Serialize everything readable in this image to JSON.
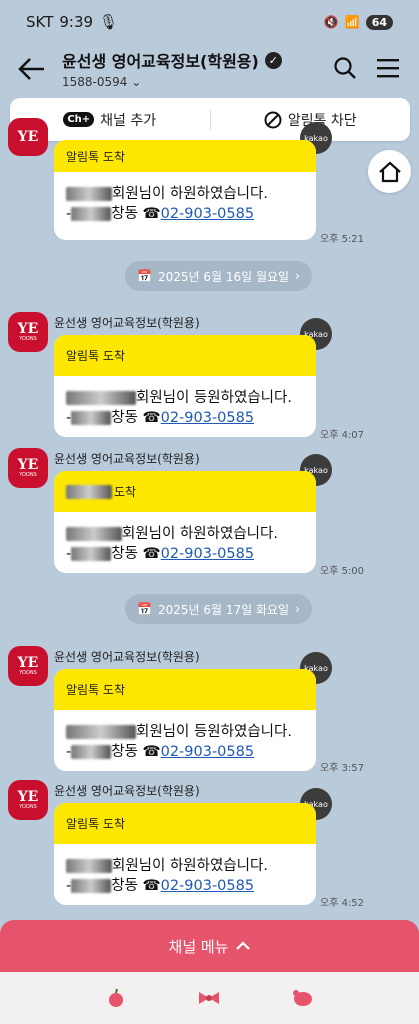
{
  "status": {
    "carrier": "SKT",
    "time": "9:39",
    "battery": "64"
  },
  "header": {
    "title": "윤선생 영어교육정보(학원용)",
    "phone": "1588-0594"
  },
  "actions": {
    "add_channel": "채널 추가",
    "block": "알림톡 차단"
  },
  "messages": [
    {
      "sender": "",
      "head": "알림톡 도착",
      "line1_suffix": "회원님이 하원하였습니다.",
      "line2_mid": "창동 ☎",
      "phone_link": "02-903-0585",
      "time": "오후 5:21"
    },
    {
      "sender": "윤선생 영어교육정보(학원용)",
      "head": "알림톡 도착",
      "line1_suffix": "회원님이 등원하였습니다.",
      "line2_mid": "창동 ☎",
      "phone_link": "02-903-0585",
      "time": "오후 4:07"
    },
    {
      "sender": "윤선생 영어교육정보(학원용)",
      "head": "도착",
      "line1_suffix": "회원님이 하원하였습니다.",
      "line2_mid": "창동 ☎",
      "phone_link": "02-903-0585",
      "time": "오후 5:00"
    },
    {
      "sender": "윤선생 영어교육정보(학원용)",
      "head": "알림톡 도착",
      "line1_suffix": "회원님이 등원하였습니다.",
      "line2_mid": "창동 ☎",
      "phone_link": "02-903-0585",
      "time": "오후 3:57"
    },
    {
      "sender": "윤선생 영어교육정보(학원용)",
      "head": "알림톡 도착",
      "line1_suffix": "회원님이 하원하였습니다.",
      "line2_mid": "창동 ☎",
      "phone_link": "02-903-0585",
      "time": "오후 4:52"
    }
  ],
  "dates": [
    "2025년 6월 16일 월요일",
    "2025년 6월 17일 화요일"
  ],
  "avatar": {
    "big": "YE",
    "small": "YOONS"
  },
  "kakao_label": "kakao",
  "bottom": {
    "channel_menu": "채널 메뉴"
  },
  "colors": {
    "background": "#b9cadb",
    "bubble_head": "#fde700",
    "accent": "#e5546a",
    "link": "#1e5ab4"
  }
}
